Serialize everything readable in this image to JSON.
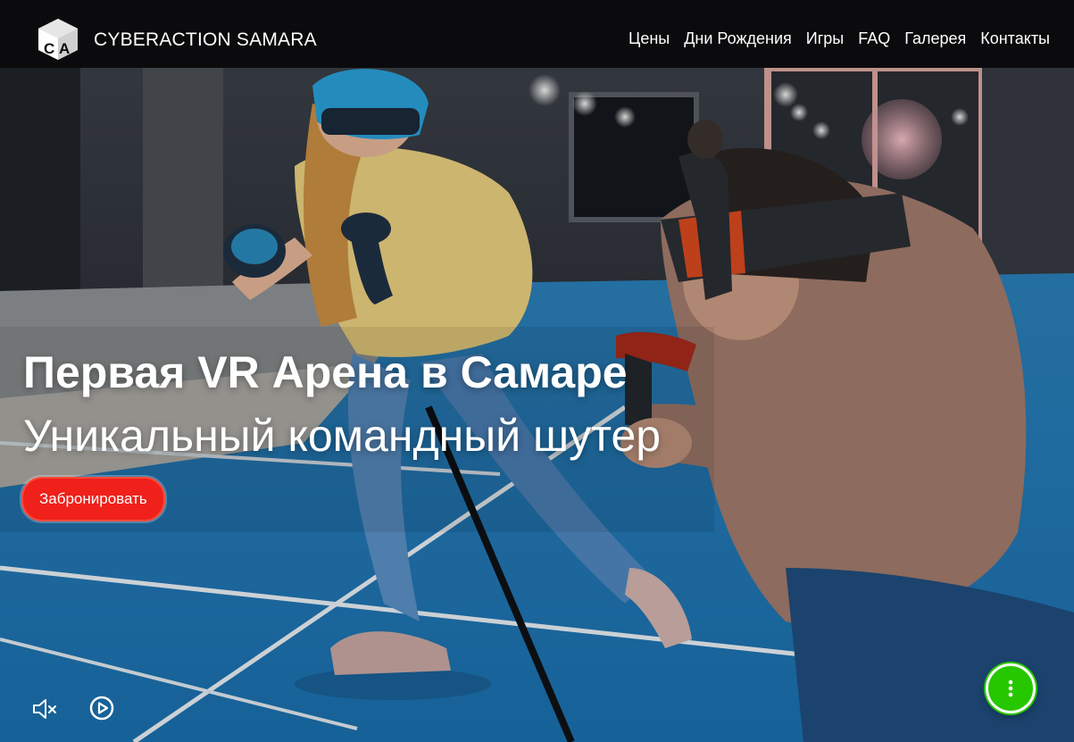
{
  "header": {
    "brand": "CYBERACTION SAMARA",
    "logo_icon": "cube-ca-logo",
    "nav": [
      {
        "label": "Цены"
      },
      {
        "label": "Дни Рождения"
      },
      {
        "label": "Игры"
      },
      {
        "label": "FAQ"
      },
      {
        "label": "Галерея"
      },
      {
        "label": "Контакты"
      }
    ]
  },
  "hero": {
    "headline": "Первая VR Арена в Самаре",
    "subheadline": "Уникальный командный шутер",
    "cta_label": "Забронировать",
    "background": "vr-players-arena-photo"
  },
  "video_controls": {
    "mute_icon": "speaker-muted-icon",
    "play_icon": "play-circle-icon"
  },
  "fab": {
    "icon": "vertical-dots-icon"
  },
  "colors": {
    "header_bg": "#0b0b0d",
    "cta_red": "#f0201a",
    "fab_green": "#27c700",
    "floor_blue": "#1f8ac8"
  }
}
